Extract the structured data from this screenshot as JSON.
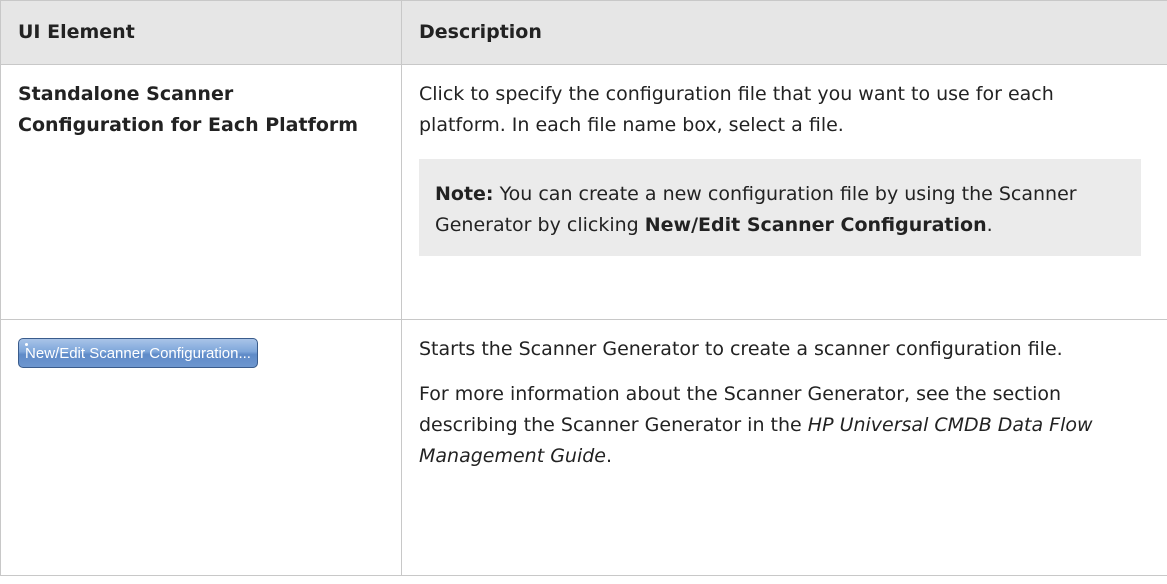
{
  "header": {
    "col1": "UI Element",
    "col2": "Description"
  },
  "rows": [
    {
      "element_line1": "Standalone Scanner",
      "element_line2": "Configuration for Each Platform",
      "desc": "Click to specify the configuration file that you want to use for each platform. In each file name box, select a file.",
      "note_label": "Note:",
      "note_text_before": " You can create a new configuration file by using the Scanner Generator by clicking ",
      "note_bold": "New/Edit Scanner Configuration",
      "note_text_after": "."
    },
    {
      "button_label": "New/Edit Scanner Configuration...",
      "desc1": "Starts the Scanner Generator to create a scanner configuration file.",
      "desc2_before": "For more information about the Scanner Generator, see the section describing the Scanner Generator in the ",
      "desc2_italic": "HP Universal CMDB Data Flow Management Guide",
      "desc2_after": "."
    }
  ]
}
